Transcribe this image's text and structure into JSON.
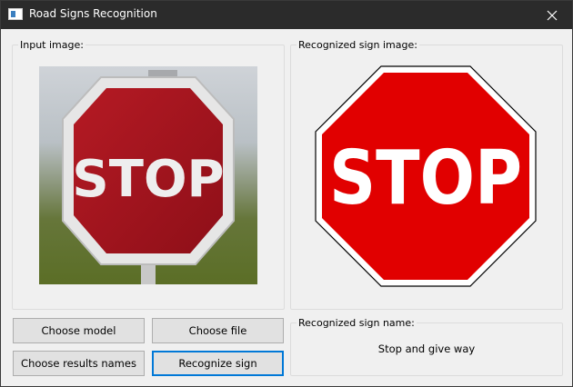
{
  "window": {
    "title": "Road Signs Recognition",
    "app_icon": "window-icon",
    "close_icon": "close-icon"
  },
  "input_panel": {
    "title": "Input image:",
    "image_text": "STOP"
  },
  "recognized_panel": {
    "title": "Recognized sign image:",
    "sign_text": "STOP"
  },
  "buttons": {
    "choose_model": "Choose model",
    "choose_file": "Choose file",
    "choose_results_names": "Choose results names",
    "recognize_sign": "Recognize sign"
  },
  "result_panel": {
    "title": "Recognized sign name:",
    "value": "Stop and give way"
  },
  "colors": {
    "sign_red": "#e10000",
    "focus_blue": "#0078d7",
    "titlebar": "#2b2b2b"
  }
}
